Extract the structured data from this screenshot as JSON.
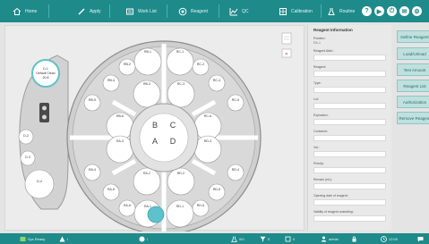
{
  "nav": {
    "home": "Home",
    "apply": "Apply",
    "worklist": "Work List",
    "reagent": "Reagent",
    "qc": "QC",
    "calibration": "Calibration",
    "routine": "Routine"
  },
  "top_icons": [
    "?",
    "▶",
    "⏻",
    "✉",
    "⚙"
  ],
  "tray": {
    "center_labels": [
      "B",
      "C",
      "A",
      "D"
    ],
    "diluent_label": "D-1",
    "diluent_sublabel": "Default Clean",
    "diluent_volume": "20.8",
    "side_small": [
      "D-2",
      "D-3",
      "D-4"
    ],
    "positions_b": [
      "RB-1",
      "RB-2",
      "RB-3",
      "RB-4",
      "RB-5",
      "RB-6"
    ],
    "positions_c": [
      "RC-1",
      "RC-2",
      "RC-3",
      "RC-4",
      "RC-5",
      "RC-6"
    ],
    "positions_a": [
      "RA-1",
      "RA-2",
      "RA-3",
      "RA-4",
      "RA-5",
      "RA-6"
    ],
    "positions_d": [
      "RD-1",
      "RD-2",
      "RD-3",
      "RD-4",
      "RD-5",
      "RD-6"
    ]
  },
  "toolbar_small": [
    "",
    "R"
  ],
  "info": {
    "title": "Reagent Information",
    "position_label": "Position:",
    "position_value": "RA-1",
    "fields": [
      "Reagent Abbr.:",
      "Reagent:",
      "Type:",
      "Lot:",
      "Expiration:",
      "Container:",
      "Vol.:",
      "Priority:",
      "Remain (mL):",
      "Opening date of reagent:",
      "Validity of reagent unsealing:"
    ]
  },
  "side_buttons": [
    "Define Reagent",
    "Load/Unload",
    "Test Amount",
    "Reagent List",
    "Authorization",
    "Remove Reagent"
  ],
  "bottom": {
    "left": "Sys Ready",
    "items": [
      "!",
      "i",
      "0/0",
      "0",
      "0",
      "admin",
      "12:00"
    ]
  },
  "colors": {
    "accent": "#1f8a8a",
    "selected": "#5fc1cc",
    "button_bg": "#bfe0de"
  }
}
